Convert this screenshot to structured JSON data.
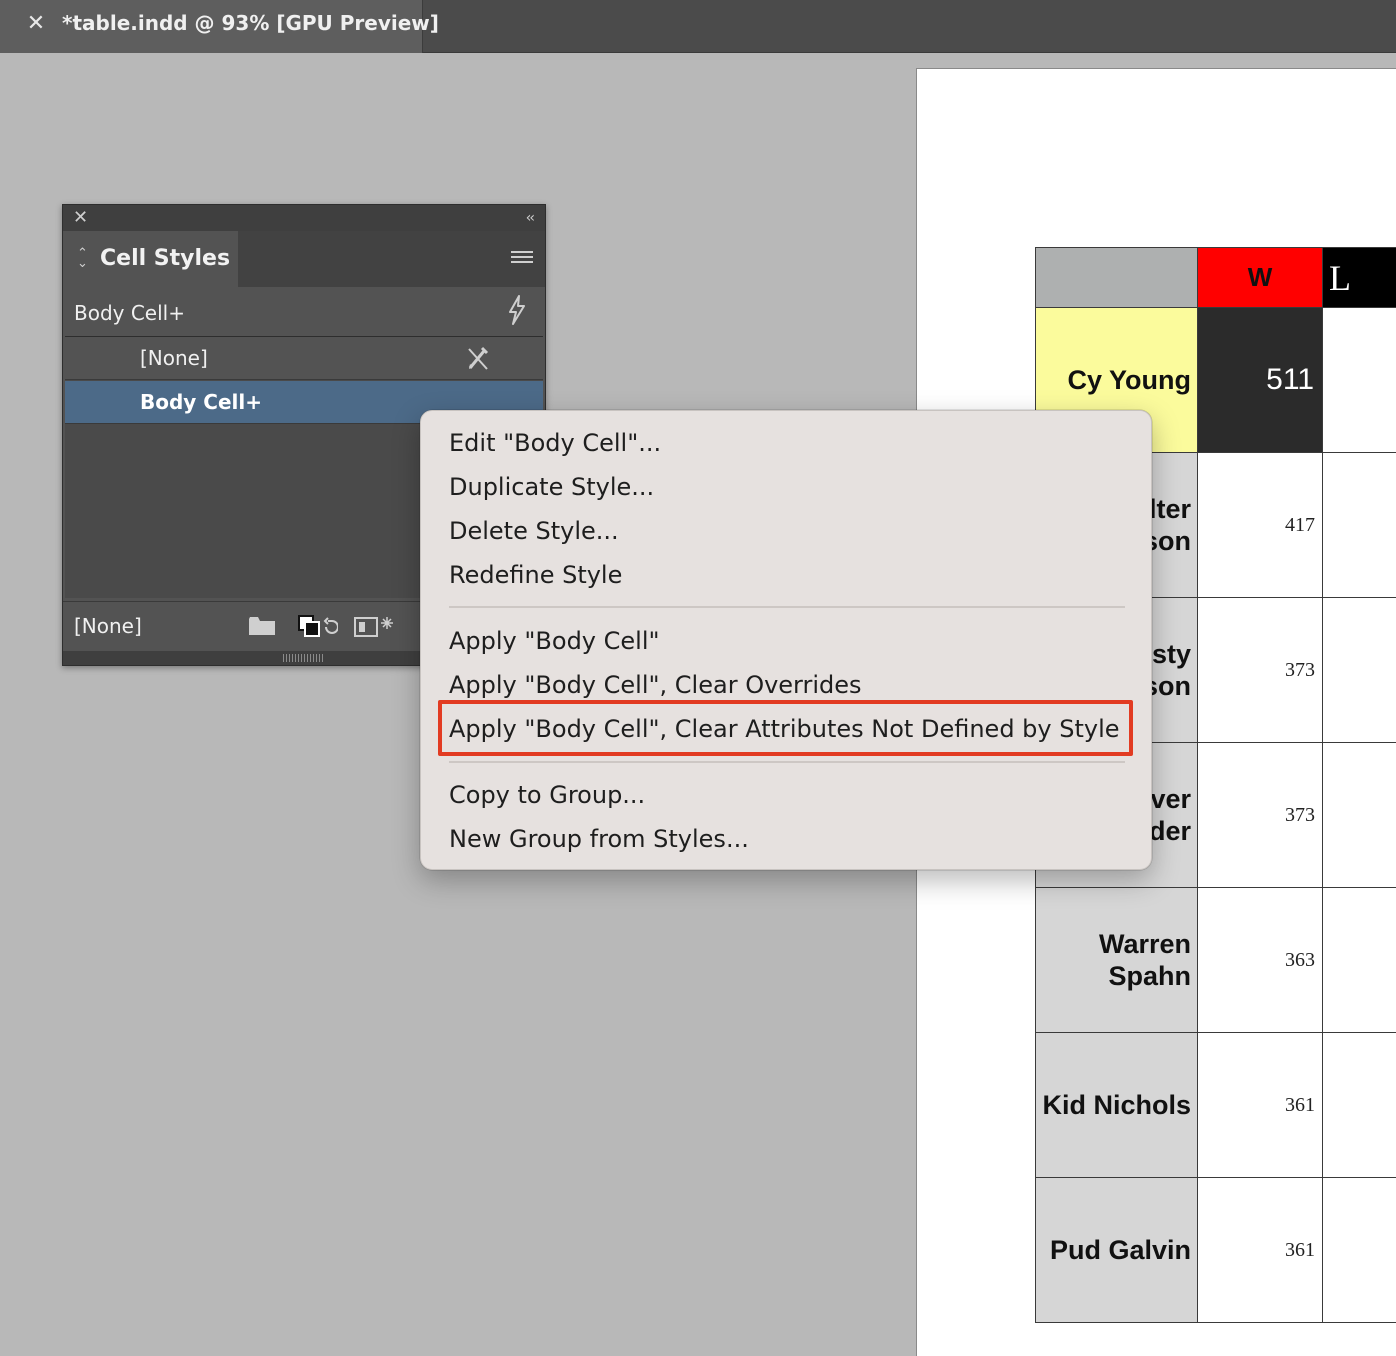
{
  "tab": {
    "title": "*table.indd @ 93% [GPU Preview]"
  },
  "panel": {
    "tab_label": "Cell Styles",
    "current_style": "Body Cell+",
    "styles": [
      "[None]",
      "Body Cell+"
    ],
    "default_style": "[None]"
  },
  "context_menu": {
    "items": [
      "Edit \"Body Cell\"...",
      "Duplicate Style...",
      "Delete Style...",
      "Redefine Style",
      "Apply \"Body Cell\"",
      "Apply \"Body Cell\", Clear Overrides",
      "Apply \"Body Cell\", Clear Attributes Not Defined by Style",
      "Copy to Group...",
      "New Group from Styles..."
    ],
    "highlighted_index": 6,
    "highlight_color": "#e23b22"
  },
  "table": {
    "headers": {
      "w": "W",
      "l": "L"
    },
    "rows": [
      {
        "name": [
          "Cy Young"
        ],
        "w": "511"
      },
      {
        "name": [
          "lter",
          "son"
        ],
        "w": "417"
      },
      {
        "name": [
          "sty",
          "son"
        ],
        "w": "373"
      },
      {
        "name": [
          "ver",
          "der"
        ],
        "w": "373"
      },
      {
        "name": [
          "Warren",
          "Spahn"
        ],
        "w": "363"
      },
      {
        "name": [
          "Kid Nichols"
        ],
        "w": "361"
      },
      {
        "name": [
          "Pud Galvin"
        ],
        "w": "361"
      }
    ],
    "colors": {
      "header_w": "#ff0000",
      "header_l": "#000000",
      "first_name_bg": "#fbfb9c",
      "first_value_bg": "#2b2b2b"
    }
  }
}
